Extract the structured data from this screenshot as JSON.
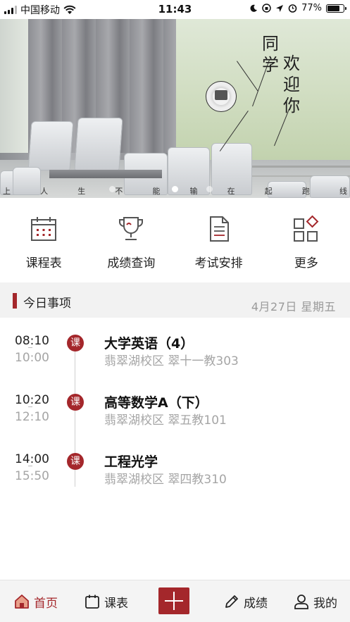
{
  "status_bar": {
    "carrier": "中国移动",
    "time": "11:43",
    "battery_percent": "77%",
    "battery_level": 0.77,
    "icons": [
      "signal-icon",
      "wifi-icon",
      "moon-icon",
      "orientation-lock-icon",
      "location-icon",
      "alarm-icon",
      "battery-icon"
    ]
  },
  "banner": {
    "welcome_col1": "同学",
    "welcome_col2": "欢迎你",
    "motto": [
      "人",
      "生",
      "不",
      "能",
      "输",
      "在",
      "起",
      "跑",
      "线"
    ],
    "motto_prefix": "上",
    "page_count": 3,
    "active_page": 1
  },
  "quick_actions": [
    {
      "label": "课程表",
      "icon": "calendar-icon"
    },
    {
      "label": "成绩查询",
      "icon": "trophy-icon"
    },
    {
      "label": "考试安排",
      "icon": "document-icon"
    },
    {
      "label": "更多",
      "icon": "apps-icon"
    }
  ],
  "today": {
    "title": "今日事项",
    "date": "4月27日 星期五",
    "badge_text": "课",
    "events": [
      {
        "start": "08:10",
        "end": "10:00",
        "name": "大学英语（4）",
        "location": "翡翠湖校区 翠十一教303"
      },
      {
        "start": "10:20",
        "end": "12:10",
        "name": "高等数学A（下）",
        "location": "翡翠湖校区 翠五教101"
      },
      {
        "start": "14:00",
        "end": "15:50",
        "name": "工程光学",
        "location": "翡翠湖校区 翠四教310"
      }
    ]
  },
  "tabbar": {
    "home": "首页",
    "schedule": "课表",
    "grades": "成绩",
    "me": "我的"
  },
  "colors": {
    "accent": "#a4272b",
    "muted_text": "#a5a5a5",
    "section_bg": "#f2f2f2"
  }
}
